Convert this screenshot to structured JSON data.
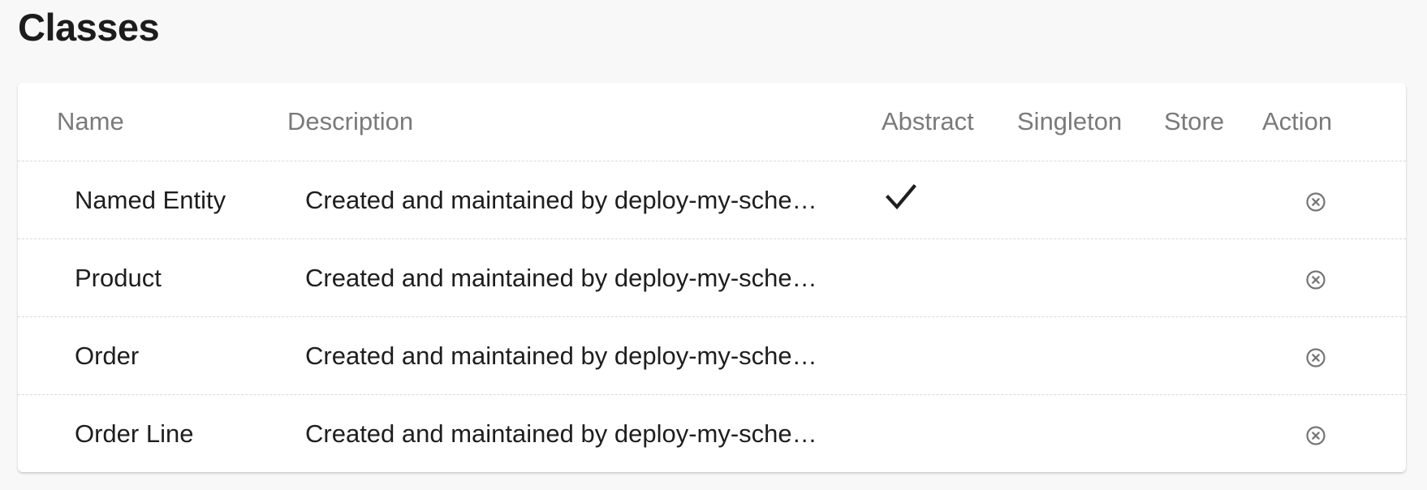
{
  "page": {
    "title": "Classes"
  },
  "table": {
    "columns": [
      "Name",
      "Description",
      "Abstract",
      "Singleton",
      "Store",
      "Action"
    ],
    "rows": [
      {
        "name": "Named Entity",
        "description": "Created and maintained by deploy-my-sche…",
        "abstract": true,
        "singleton": false,
        "store": false,
        "action_icon": "remove-circle-icon"
      },
      {
        "name": "Product",
        "description": "Created and maintained by deploy-my-sche…",
        "abstract": false,
        "singleton": false,
        "store": false,
        "action_icon": "remove-circle-icon"
      },
      {
        "name": "Order",
        "description": "Created and maintained by deploy-my-sche…",
        "abstract": false,
        "singleton": false,
        "store": false,
        "action_icon": "remove-circle-icon"
      },
      {
        "name": "Order Line",
        "description": "Created and maintained by deploy-my-sche…",
        "abstract": false,
        "singleton": false,
        "store": false,
        "action_icon": "remove-circle-icon"
      }
    ]
  },
  "colors": {
    "background": "#f8f8f8",
    "card": "#ffffff",
    "header_text": "#7a7a7a",
    "body_text": "#1e1e1e",
    "icon": "#757575"
  }
}
